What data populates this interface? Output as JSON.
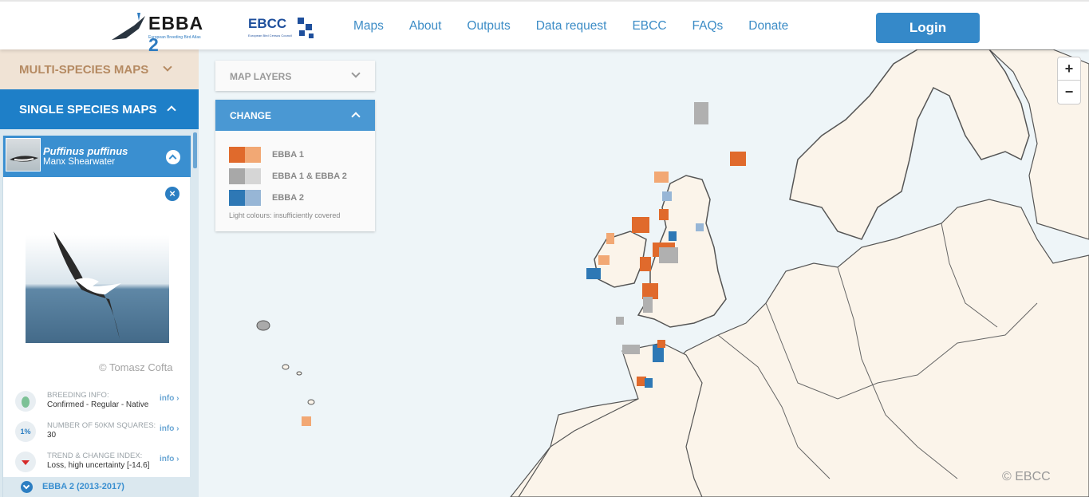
{
  "header": {
    "logo_text": "EBBA",
    "logo_num": "2",
    "logo_sub": "European Breeding Bird Atlas",
    "partner_logo": "EBCC",
    "partner_sub": "European Bird Census Council",
    "nav": [
      "Maps",
      "About",
      "Outputs",
      "Data request",
      "EBCC",
      "FAQs",
      "Donate"
    ],
    "login_label": "Login"
  },
  "sidebar": {
    "multi_label": "MULTI-SPECIES MAPS",
    "single_label": "SINGLE SPECIES MAPS",
    "species": {
      "latin": "Puffinus puffinus",
      "common": "Manx Shearwater",
      "photo_credit": "© Tomasz Cofta"
    },
    "info": [
      {
        "label": "BREEDING INFO:",
        "value": "Confirmed - Regular - Native",
        "link": "info",
        "icon": "egg-icon"
      },
      {
        "label": "NUMBER OF 50KM SQUARES:",
        "value": "30",
        "link": "info",
        "icon": "percent-icon",
        "icon_text": "1%"
      },
      {
        "label": "TREND & CHANGE INDEX:",
        "value": "Loss, high uncertainty [-14.6]",
        "link": "info",
        "icon": "trend-down-icon"
      }
    ],
    "ebba_bar": "EBBA 2 (2013-2017)"
  },
  "map": {
    "layers_label": "MAP LAYERS",
    "change_label": "CHANGE",
    "legend": [
      {
        "label": "EBBA 1",
        "dark": "#e06a2c",
        "light": "#f2a874"
      },
      {
        "label": "EBBA 1 & EBBA 2",
        "dark": "#a8a8a8",
        "light": "#d6d6d6"
      },
      {
        "label": "EBBA 2",
        "dark": "#2e78b5",
        "light": "#97b6d6"
      }
    ],
    "note": "Light colours: insufficiently covered",
    "zoom_in": "+",
    "zoom_out": "−",
    "copyright": "© EBCC"
  }
}
